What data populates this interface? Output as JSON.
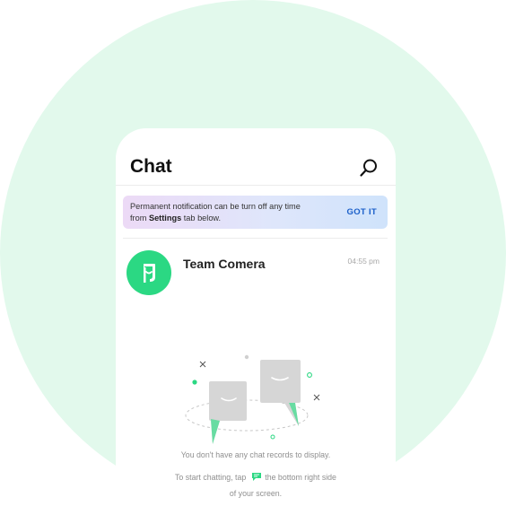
{
  "header": {
    "title": "Chat",
    "search_icon": "search-icon"
  },
  "notice": {
    "line1": "Permanent notification can be turn off any time",
    "line2_prefix": "from ",
    "line2_bold": "Settings",
    "line2_suffix": " tab below.",
    "action_label": "GOT IT"
  },
  "chats": [
    {
      "name": "Team Comera",
      "time": "04:55 pm",
      "avatar_icon": "comera-logo-icon",
      "avatar_color": "#2bd883"
    }
  ],
  "empty_state": {
    "illustration": "chat-bubbles-illustration",
    "line1": "You don't have any chat records to display.",
    "line2_prefix": "To start chatting, tap",
    "line2_icon": "new-chat-icon",
    "line2_suffix": "the bottom right side",
    "line3": "of your screen."
  },
  "colors": {
    "background_circle": "#e2f9ec",
    "accent_green": "#2bd883",
    "action_blue": "#1a5fc9"
  }
}
